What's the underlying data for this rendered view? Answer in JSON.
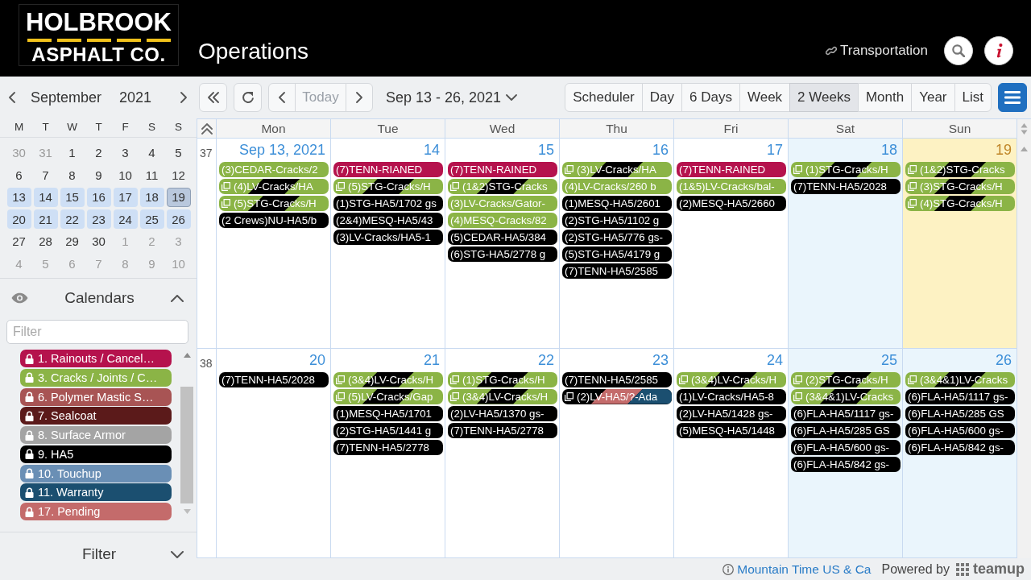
{
  "header": {
    "logo": {
      "line_1": "HOLBROOK",
      "line_2": "ASPHALT CO."
    },
    "title": "Operations",
    "link": "Transportation"
  },
  "mini_calendar": {
    "month": "September",
    "year": "2021",
    "weekdays": [
      "M",
      "T",
      "W",
      "T",
      "F",
      "S",
      "S"
    ],
    "weeks": [
      [
        {
          "label": "30",
          "other_month": true,
          "in_range": false,
          "today": false
        },
        {
          "label": "31",
          "other_month": true,
          "in_range": false,
          "today": false
        },
        {
          "label": "1",
          "other_month": false,
          "in_range": false,
          "today": false
        },
        {
          "label": "2",
          "other_month": false,
          "in_range": false,
          "today": false
        },
        {
          "label": "3",
          "other_month": false,
          "in_range": false,
          "today": false
        },
        {
          "label": "4",
          "other_month": false,
          "in_range": false,
          "today": false
        },
        {
          "label": "5",
          "other_month": false,
          "in_range": false,
          "today": false
        }
      ],
      [
        {
          "label": "6",
          "other_month": false,
          "in_range": false,
          "today": false
        },
        {
          "label": "7",
          "other_month": false,
          "in_range": false,
          "today": false
        },
        {
          "label": "8",
          "other_month": false,
          "in_range": false,
          "today": false
        },
        {
          "label": "9",
          "other_month": false,
          "in_range": false,
          "today": false
        },
        {
          "label": "10",
          "other_month": false,
          "in_range": false,
          "today": false
        },
        {
          "label": "11",
          "other_month": false,
          "in_range": false,
          "today": false
        },
        {
          "label": "12",
          "other_month": false,
          "in_range": false,
          "today": false
        }
      ],
      [
        {
          "label": "13",
          "other_month": false,
          "in_range": true,
          "today": false
        },
        {
          "label": "14",
          "other_month": false,
          "in_range": true,
          "today": false
        },
        {
          "label": "15",
          "other_month": false,
          "in_range": true,
          "today": false
        },
        {
          "label": "16",
          "other_month": false,
          "in_range": true,
          "today": false
        },
        {
          "label": "17",
          "other_month": false,
          "in_range": true,
          "today": false
        },
        {
          "label": "18",
          "other_month": false,
          "in_range": true,
          "today": false
        },
        {
          "label": "19",
          "other_month": false,
          "in_range": true,
          "today": true
        }
      ],
      [
        {
          "label": "20",
          "other_month": false,
          "in_range": true,
          "today": false
        },
        {
          "label": "21",
          "other_month": false,
          "in_range": true,
          "today": false
        },
        {
          "label": "22",
          "other_month": false,
          "in_range": true,
          "today": false
        },
        {
          "label": "23",
          "other_month": false,
          "in_range": true,
          "today": false
        },
        {
          "label": "24",
          "other_month": false,
          "in_range": true,
          "today": false
        },
        {
          "label": "25",
          "other_month": false,
          "in_range": true,
          "today": false
        },
        {
          "label": "26",
          "other_month": false,
          "in_range": true,
          "today": false
        }
      ],
      [
        {
          "label": "27",
          "other_month": false,
          "in_range": false,
          "today": false
        },
        {
          "label": "28",
          "other_month": false,
          "in_range": false,
          "today": false
        },
        {
          "label": "29",
          "other_month": false,
          "in_range": false,
          "today": false
        },
        {
          "label": "30",
          "other_month": false,
          "in_range": false,
          "today": false
        },
        {
          "label": "1",
          "other_month": true,
          "in_range": false,
          "today": false
        },
        {
          "label": "2",
          "other_month": true,
          "in_range": false,
          "today": false
        },
        {
          "label": "3",
          "other_month": true,
          "in_range": false,
          "today": false
        }
      ],
      [
        {
          "label": "4",
          "other_month": true,
          "in_range": false,
          "today": false
        },
        {
          "label": "5",
          "other_month": true,
          "in_range": false,
          "today": false
        },
        {
          "label": "6",
          "other_month": true,
          "in_range": false,
          "today": false
        },
        {
          "label": "7",
          "other_month": true,
          "in_range": false,
          "today": false
        },
        {
          "label": "8",
          "other_month": true,
          "in_range": false,
          "today": false
        },
        {
          "label": "9",
          "other_month": true,
          "in_range": false,
          "today": false
        },
        {
          "label": "10",
          "other_month": true,
          "in_range": false,
          "today": false
        }
      ]
    ]
  },
  "calendars": {
    "title": "Calendars",
    "expanded": true,
    "filter": {
      "placeholder": "Filter"
    },
    "items": [
      {
        "label": "1. Rainouts / Cancel…",
        "color": "#b5124d"
      },
      {
        "label": "3. Cracks / Joints / C…",
        "color": "#8bb446"
      },
      {
        "label": "6. Polymer Mastic S…",
        "color": "#a85454"
      },
      {
        "label": "7. Sealcoat",
        "color": "#5b1a1a"
      },
      {
        "label": "8. Surface Armor",
        "color": "#a4a4a4"
      },
      {
        "label": "9. HA5",
        "color": "#000000"
      },
      {
        "label": "10. Touchup",
        "color": "#6a8fb5"
      },
      {
        "label": "11. Warranty",
        "color": "#1b4f70"
      },
      {
        "label": "17. Pending",
        "color": "#c46b6b"
      }
    ]
  },
  "filter_panel": {
    "title": "Filter",
    "expanded": false
  },
  "toolbar": {
    "today": {
      "label": "Today",
      "disabled": true
    },
    "range": "Sep 13 - 26, 2021",
    "views": [
      {
        "label": "Scheduler",
        "selected": false
      },
      {
        "label": "Day",
        "selected": false
      },
      {
        "label": "6 Days",
        "selected": false
      },
      {
        "label": "Week",
        "selected": false
      },
      {
        "label": "2 Weeks",
        "selected": true
      },
      {
        "label": "Month",
        "selected": false
      },
      {
        "label": "Year",
        "selected": false
      },
      {
        "label": "List",
        "selected": false
      }
    ]
  },
  "grid": {
    "weekdays": [
      "Mon",
      "Tue",
      "Wed",
      "Thu",
      "Fri",
      "Sat",
      "Sun"
    ],
    "weeks": [
      {
        "number": "37",
        "days": [
          {
            "label": "Sep 13, 2021",
            "weekend": false,
            "today": false,
            "events": [
              {
                "title": "(3)CEDAR-Cracks/2",
                "calendars": [
                  {
                    "color": "#8bb446"
                  }
                ],
                "recurring": false
              },
              {
                "title": "(4)LV-Cracks/HA",
                "calendars": [
                  {
                    "color": "#8bb446"
                  },
                  {
                    "color": "#000000"
                  }
                ],
                "recurring": true
              },
              {
                "title": "(5)STG-Cracks/H",
                "calendars": [
                  {
                    "color": "#8bb446"
                  },
                  {
                    "color": "#000000"
                  }
                ],
                "recurring": true
              },
              {
                "title": "(2 Crews)NU-HA5/b",
                "calendars": [
                  {
                    "color": "#000000"
                  }
                ],
                "recurring": false
              }
            ]
          },
          {
            "label": "14",
            "weekend": false,
            "today": false,
            "events": [
              {
                "title": "(7)TENN-RIANED",
                "calendars": [
                  {
                    "color": "#b5124d"
                  }
                ],
                "recurring": false
              },
              {
                "title": "(5)STG-Cracks/H",
                "calendars": [
                  {
                    "color": "#8bb446"
                  },
                  {
                    "color": "#000000"
                  }
                ],
                "recurring": true
              },
              {
                "title": "(1)STG-HA5/1702 gs",
                "calendars": [
                  {
                    "color": "#000000"
                  }
                ],
                "recurring": false
              },
              {
                "title": "(2&4)MESQ-HA5/43",
                "calendars": [
                  {
                    "color": "#000000"
                  }
                ],
                "recurring": false
              },
              {
                "title": "(3)LV-Cracks/HA5-1",
                "calendars": [
                  {
                    "color": "#000000"
                  }
                ],
                "recurring": false
              }
            ]
          },
          {
            "label": "15",
            "weekend": false,
            "today": false,
            "events": [
              {
                "title": "(7)TENN-RAINED",
                "calendars": [
                  {
                    "color": "#b5124d"
                  }
                ],
                "recurring": false
              },
              {
                "title": "(1&2)STG-Cracks",
                "calendars": [
                  {
                    "color": "#8bb446"
                  },
                  {
                    "color": "#000000"
                  }
                ],
                "recurring": true
              },
              {
                "title": "(3)LV-Cracks/Gator-",
                "calendars": [
                  {
                    "color": "#8bb446"
                  }
                ],
                "recurring": false
              },
              {
                "title": "(4)MESQ-Cracks/82",
                "calendars": [
                  {
                    "color": "#8bb446"
                  }
                ],
                "recurring": false
              },
              {
                "title": "(5)CEDAR-HA5/384",
                "calendars": [
                  {
                    "color": "#000000"
                  }
                ],
                "recurring": false
              },
              {
                "title": "(6)STG-HA5/2778 g",
                "calendars": [
                  {
                    "color": "#000000"
                  }
                ],
                "recurring": false
              }
            ]
          },
          {
            "label": "16",
            "weekend": false,
            "today": false,
            "events": [
              {
                "title": "(3)LV-Cracks/HA",
                "calendars": [
                  {
                    "color": "#8bb446"
                  },
                  {
                    "color": "#000000"
                  }
                ],
                "recurring": true
              },
              {
                "title": "(4)LV-Cracks/260 b",
                "calendars": [
                  {
                    "color": "#8bb446"
                  }
                ],
                "recurring": false
              },
              {
                "title": "(1)MESQ-HA5/2601",
                "calendars": [
                  {
                    "color": "#000000"
                  }
                ],
                "recurring": false
              },
              {
                "title": "(2)STG-HA5/1102 g",
                "calendars": [
                  {
                    "color": "#000000"
                  }
                ],
                "recurring": false
              },
              {
                "title": "(2)STG-HA5/776 gs-",
                "calendars": [
                  {
                    "color": "#000000"
                  }
                ],
                "recurring": false
              },
              {
                "title": "(5)STG-HA5/4179 g",
                "calendars": [
                  {
                    "color": "#000000"
                  }
                ],
                "recurring": false
              },
              {
                "title": "(7)TENN-HA5/2585",
                "calendars": [
                  {
                    "color": "#000000"
                  }
                ],
                "recurring": false
              }
            ]
          },
          {
            "label": "17",
            "weekend": false,
            "today": false,
            "events": [
              {
                "title": "(7)TENN-RAINED",
                "calendars": [
                  {
                    "color": "#b5124d"
                  }
                ],
                "recurring": false
              },
              {
                "title": "(1&5)LV-Cracks/bal-",
                "calendars": [
                  {
                    "color": "#8bb446"
                  }
                ],
                "recurring": false
              },
              {
                "title": "(2)MESQ-HA5/2660",
                "calendars": [
                  {
                    "color": "#000000"
                  }
                ],
                "recurring": false
              }
            ]
          },
          {
            "label": "18",
            "weekend": true,
            "today": false,
            "events": [
              {
                "title": "(1)STG-Cracks/H",
                "calendars": [
                  {
                    "color": "#8bb446"
                  },
                  {
                    "color": "#000000"
                  }
                ],
                "recurring": true
              },
              {
                "title": "(7)TENN-HA5/2028",
                "calendars": [
                  {
                    "color": "#000000"
                  }
                ],
                "recurring": false
              }
            ]
          },
          {
            "label": "19",
            "weekend": true,
            "today": true,
            "events": [
              {
                "title": "(1&2)STG-Cracks",
                "calendars": [
                  {
                    "color": "#8bb446"
                  },
                  {
                    "color": "#000000"
                  }
                ],
                "recurring": true
              },
              {
                "title": "(3)STG-Cracks/H",
                "calendars": [
                  {
                    "color": "#8bb446"
                  },
                  {
                    "color": "#000000"
                  }
                ],
                "recurring": true
              },
              {
                "title": "(4)STG-Cracks/H",
                "calendars": [
                  {
                    "color": "#8bb446"
                  },
                  {
                    "color": "#000000"
                  }
                ],
                "recurring": true
              }
            ]
          }
        ]
      },
      {
        "number": "38",
        "days": [
          {
            "label": "20",
            "weekend": false,
            "today": false,
            "events": [
              {
                "title": "(7)TENN-HA5/2028",
                "calendars": [
                  {
                    "color": "#000000"
                  }
                ],
                "recurring": false
              }
            ]
          },
          {
            "label": "21",
            "weekend": false,
            "today": false,
            "events": [
              {
                "title": "(3&4)LV-Cracks/H",
                "calendars": [
                  {
                    "color": "#8bb446"
                  },
                  {
                    "color": "#000000"
                  }
                ],
                "recurring": true
              },
              {
                "title": "(5)LV-Cracks/Gap",
                "calendars": [
                  {
                    "color": "#8bb446"
                  },
                  {
                    "color": "#000000"
                  }
                ],
                "recurring": true
              },
              {
                "title": "(1)MESQ-HA5/1701",
                "calendars": [
                  {
                    "color": "#000000"
                  }
                ],
                "recurring": false
              },
              {
                "title": "(2)STG-HA5/1441 g",
                "calendars": [
                  {
                    "color": "#000000"
                  }
                ],
                "recurring": false
              },
              {
                "title": "(7)TENN-HA5/2778",
                "calendars": [
                  {
                    "color": "#000000"
                  }
                ],
                "recurring": false
              }
            ]
          },
          {
            "label": "22",
            "weekend": false,
            "today": false,
            "events": [
              {
                "title": "(1)STG-Cracks/H",
                "calendars": [
                  {
                    "color": "#8bb446"
                  },
                  {
                    "color": "#000000"
                  }
                ],
                "recurring": true
              },
              {
                "title": "(3&4)LV-Cracks/H",
                "calendars": [
                  {
                    "color": "#8bb446"
                  },
                  {
                    "color": "#000000"
                  }
                ],
                "recurring": true
              },
              {
                "title": "(2)LV-HA5/1370 gs-",
                "calendars": [
                  {
                    "color": "#000000"
                  }
                ],
                "recurring": false
              },
              {
                "title": "(7)TENN-HA5/2778",
                "calendars": [
                  {
                    "color": "#000000"
                  }
                ],
                "recurring": false
              }
            ]
          },
          {
            "label": "23",
            "weekend": false,
            "today": false,
            "events": [
              {
                "title": "(7)TENN-HA5/2585",
                "calendars": [
                  {
                    "color": "#000000"
                  }
                ],
                "recurring": false
              },
              {
                "title": "(2)LV-HA5/?-Ada",
                "calendars": [
                  {
                    "color": "#000000"
                  },
                  {
                    "color": "#c46b6b"
                  },
                  {
                    "color": "#1b4f70"
                  }
                ],
                "recurring": true
              }
            ]
          },
          {
            "label": "24",
            "weekend": false,
            "today": false,
            "events": [
              {
                "title": "(3&4)LV-Cracks/H",
                "calendars": [
                  {
                    "color": "#8bb446"
                  },
                  {
                    "color": "#000000"
                  }
                ],
                "recurring": true
              },
              {
                "title": "(1)LV-Cracks/HA5-8",
                "calendars": [
                  {
                    "color": "#000000"
                  }
                ],
                "recurring": false
              },
              {
                "title": "(2)LV-HA5/1428 gs-",
                "calendars": [
                  {
                    "color": "#000000"
                  }
                ],
                "recurring": false
              },
              {
                "title": "(5)MESQ-HA5/1448",
                "calendars": [
                  {
                    "color": "#000000"
                  }
                ],
                "recurring": false
              }
            ]
          },
          {
            "label": "25",
            "weekend": true,
            "today": false,
            "events": [
              {
                "title": "(2)STG-Cracks/H",
                "calendars": [
                  {
                    "color": "#8bb446"
                  },
                  {
                    "color": "#000000"
                  }
                ],
                "recurring": true
              },
              {
                "title": "(3&4&1)LV-Cracks",
                "calendars": [
                  {
                    "color": "#8bb446"
                  },
                  {
                    "color": "#000000"
                  }
                ],
                "recurring": true
              },
              {
                "title": "(6)FLA-HA5/1117 gs-",
                "calendars": [
                  {
                    "color": "#000000"
                  }
                ],
                "recurring": false
              },
              {
                "title": "(6)FLA-HA5/285 GS",
                "calendars": [
                  {
                    "color": "#000000"
                  }
                ],
                "recurring": false
              },
              {
                "title": "(6)FLA-HA5/600 gs-",
                "calendars": [
                  {
                    "color": "#000000"
                  }
                ],
                "recurring": false
              },
              {
                "title": "(6)FLA-HA5/842 gs-",
                "calendars": [
                  {
                    "color": "#000000"
                  }
                ],
                "recurring": false
              }
            ]
          },
          {
            "label": "26",
            "weekend": true,
            "today": false,
            "events": [
              {
                "title": "(3&4&1)LV-Cracks",
                "calendars": [
                  {
                    "color": "#8bb446"
                  },
                  {
                    "color": "#000000"
                  }
                ],
                "recurring": true
              },
              {
                "title": "(6)FLA-HA5/1117 gs-",
                "calendars": [
                  {
                    "color": "#000000"
                  }
                ],
                "recurring": false
              },
              {
                "title": "(6)FLA-HA5/285 GS",
                "calendars": [
                  {
                    "color": "#000000"
                  }
                ],
                "recurring": false
              },
              {
                "title": "(6)FLA-HA5/600 gs-",
                "calendars": [
                  {
                    "color": "#000000"
                  }
                ],
                "recurring": false
              },
              {
                "title": "(6)FLA-HA5/842 gs-",
                "calendars": [
                  {
                    "color": "#000000"
                  }
                ],
                "recurring": false
              }
            ]
          }
        ]
      }
    ]
  },
  "footer": {
    "timezone": "Mountain Time US & Ca",
    "powered_by": "Powered by",
    "brand": "teamup"
  }
}
